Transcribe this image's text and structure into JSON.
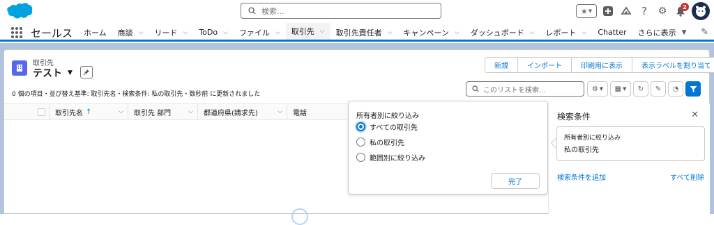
{
  "header": {
    "search_placeholder": "検索...",
    "notification_count": "2",
    "brand_color": "#0176d3"
  },
  "nav": {
    "app_name": "セールス",
    "items": [
      {
        "label": "ホーム"
      },
      {
        "label": "商談"
      },
      {
        "label": "リード"
      },
      {
        "label": "ToDo"
      },
      {
        "label": "ファイル"
      },
      {
        "label": "取引先"
      },
      {
        "label": "取引先責任者"
      },
      {
        "label": "キャンペーン"
      },
      {
        "label": "ダッシュボード"
      },
      {
        "label": "レポート"
      },
      {
        "label": "Chatter"
      },
      {
        "label": "さらに表示"
      }
    ],
    "active_item": "取引先"
  },
  "list": {
    "object_label": "取引先",
    "view_name": "テスト",
    "status": "0 個の項目・並び替え基準: 取引先名・検索条件: 私の取引先・数秒前 に更新されました",
    "search_placeholder": "このリストを検索...",
    "actions": [
      "新規",
      "インポート",
      "印刷用に表示",
      "表示ラベルを割り当て"
    ],
    "columns": [
      "取引先名",
      "取引先 部門",
      "都道府県(請求先)",
      "電話"
    ],
    "sort_arrow": "↑"
  },
  "popover": {
    "title": "所有者別に絞り込み",
    "options": [
      {
        "label": "すべての取引先",
        "checked": true
      },
      {
        "label": "私の取引先",
        "checked": false
      },
      {
        "label": "範囲別に絞り込み",
        "checked": false
      }
    ],
    "done_label": "完了"
  },
  "filter_panel": {
    "title": "検索条件",
    "close_glyph": "✕",
    "card_label": "所有者別に絞り込み",
    "card_value": "私の取引先",
    "add_label": "検索条件を追加",
    "remove_all_label": "すべて削除"
  }
}
